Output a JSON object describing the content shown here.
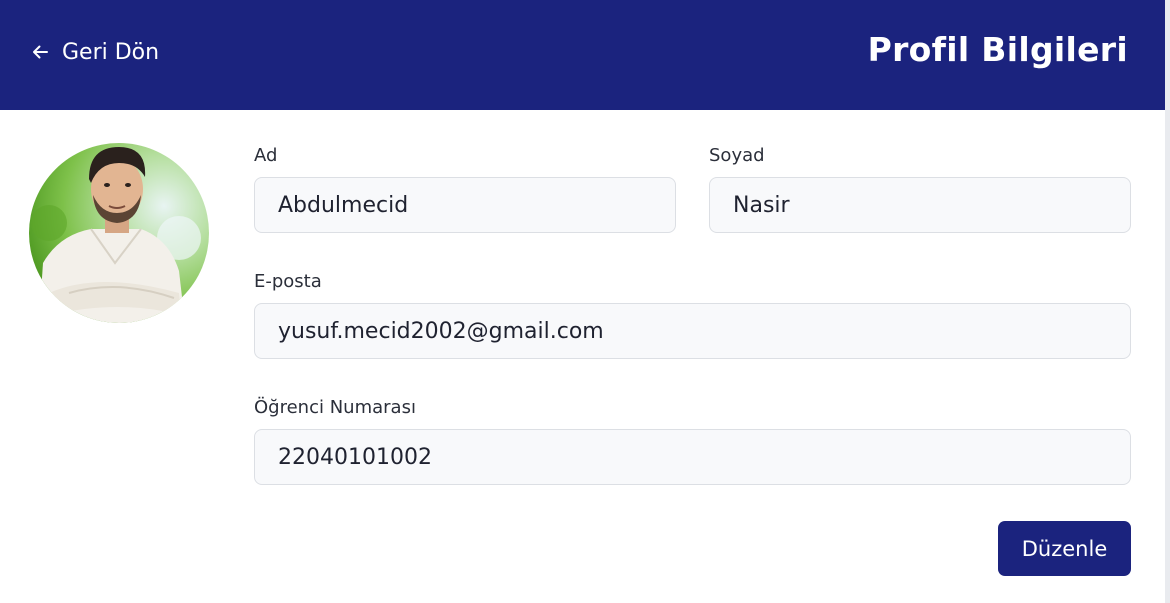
{
  "header": {
    "back_label": "Geri Dön",
    "back_icon": "arrow-left-icon",
    "title": "Profil Bilgileri",
    "background_color": "#1b237e"
  },
  "profile": {
    "avatar_icon": "profile-photo",
    "fields": {
      "first_name": {
        "label": "Ad",
        "value": "Abdulmecid"
      },
      "last_name": {
        "label": "Soyad",
        "value": "Nasir"
      },
      "email": {
        "label": "E-posta",
        "value": "yusuf.mecid2002@gmail.com"
      },
      "student_number": {
        "label": "Öğrenci Numarası",
        "value": "22040101002"
      }
    }
  },
  "actions": {
    "edit_label": "Düzenle",
    "button_color": "#1b237e"
  }
}
